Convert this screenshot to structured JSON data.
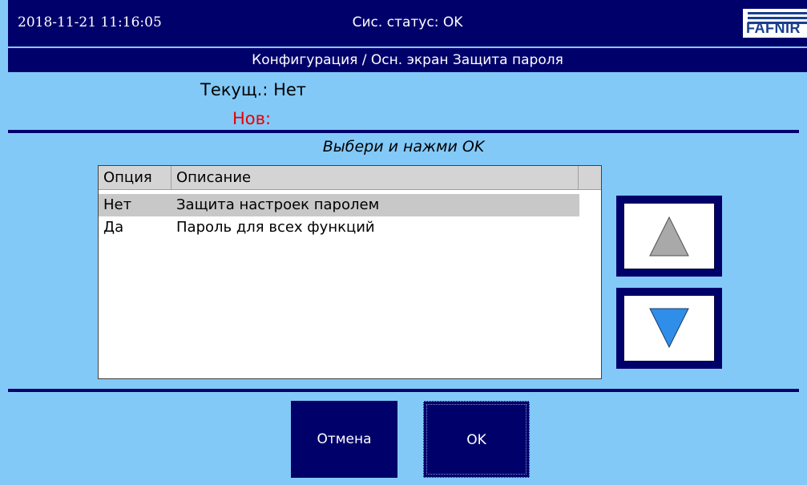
{
  "header": {
    "datetime": "2018-11-21  11:16:05",
    "system_status": "Сис. статус: OK",
    "logo_text": "FAFNIR"
  },
  "title_bar": {
    "breadcrumb": "Конфигурация / Осн. экран Защита пароля"
  },
  "values": {
    "current_label": "Текущ.: Нет",
    "new_label": "Нов:"
  },
  "prompt": "Выбери и нажми OK",
  "table": {
    "columns": [
      "Опция",
      "Описание"
    ],
    "rows": [
      {
        "option": "Нет",
        "description": "Защита настроек паролем",
        "selected": true
      },
      {
        "option": "Да",
        "description": "Пароль для всех функций",
        "selected": false
      }
    ]
  },
  "nav": {
    "up_icon": "triangle-up-icon",
    "down_icon": "triangle-down-icon",
    "up_color": "#a9a9a9",
    "down_color": "#2f8fe8"
  },
  "actions": {
    "cancel_label": "Отмена",
    "ok_label": "OK"
  },
  "colors": {
    "background": "#83c9f8",
    "bar": "#00006b",
    "new_label": "#e80000"
  }
}
